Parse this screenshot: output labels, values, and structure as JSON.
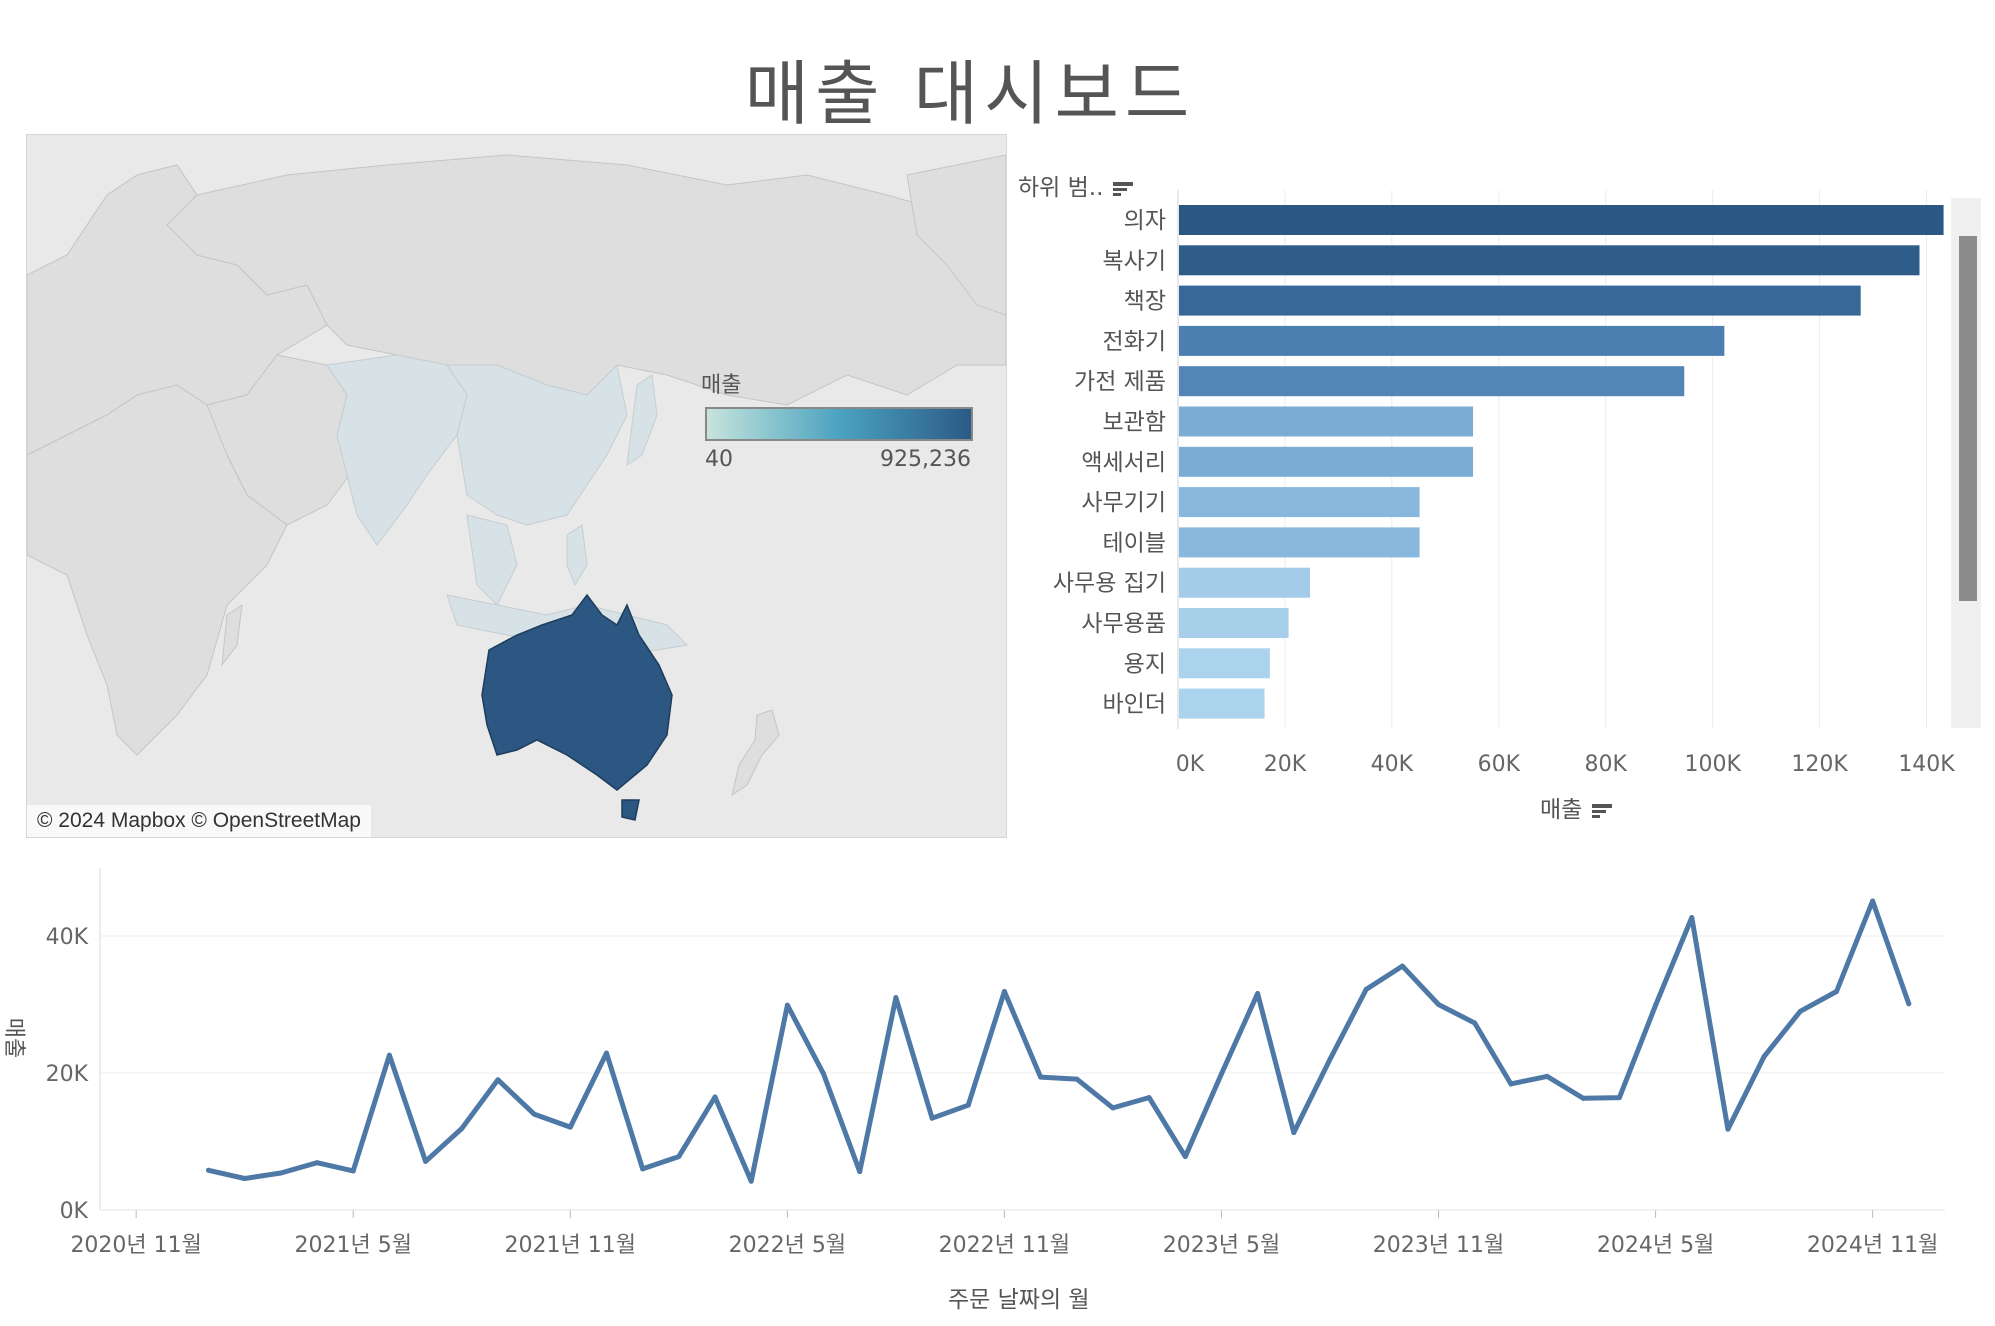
{
  "title": "매출 대시보드",
  "map": {
    "legend_title": "매출",
    "legend_min": "40",
    "legend_max": "925,236",
    "legend_colors": [
      "#c6e4dc",
      "#4ba3c0",
      "#2b5a87"
    ],
    "credit": "© 2024 Mapbox © OpenStreetMap",
    "highlight_color": "#2b5782",
    "asia_color": "#d7e2e6",
    "land_color": "#dcdcdc",
    "sea_color": "#e9e9e9"
  },
  "bar_chart": {
    "axis_title": "하위 범..",
    "x_title": "매출",
    "sort_icon": "sort-descending-icon"
  },
  "line_chart": {
    "x_title": "주문 날짜의 월",
    "y_title": "매출",
    "line_color": "#4e79a7"
  },
  "chart_data": [
    {
      "type": "bar",
      "orientation": "horizontal",
      "categories": [
        "의자",
        "복사기",
        "책장",
        "전화기",
        "가전 제품",
        "보관함",
        "액세서리",
        "사무기기",
        "테이블",
        "사무용 집기",
        "사무용품",
        "용지",
        "바인더"
      ],
      "values": [
        143000,
        138500,
        127500,
        102000,
        94500,
        55000,
        55000,
        45000,
        45000,
        24500,
        20500,
        17000,
        16000
      ],
      "colors": [
        "#2a5783",
        "#2f5d8a",
        "#386898",
        "#4c7fb1",
        "#5485b7",
        "#7aacd4",
        "#7aacd4",
        "#88b8dd",
        "#88b8dd",
        "#a4cbe8",
        "#a8cfea",
        "#acd3ee",
        "#acd3ee"
      ],
      "xlabel": "매출",
      "ylabel": "하위 범..",
      "xlim": [
        0,
        150000
      ],
      "ticks": [
        "0K",
        "20K",
        "40K",
        "60K",
        "80K",
        "100K",
        "120K",
        "140K"
      ],
      "grid": true
    },
    {
      "type": "line",
      "xlabel": "주문 날짜의 월",
      "ylabel": "매출",
      "x": [
        "2021-01",
        "2021-02",
        "2021-03",
        "2021-04",
        "2021-05",
        "2021-06",
        "2021-07",
        "2021-08",
        "2021-09",
        "2021-10",
        "2021-11",
        "2021-12",
        "2022-01",
        "2022-02",
        "2022-03",
        "2022-04",
        "2022-05",
        "2022-06",
        "2022-07",
        "2022-08",
        "2022-09",
        "2022-10",
        "2022-11",
        "2022-12",
        "2023-01",
        "2023-02",
        "2023-03",
        "2023-04",
        "2023-05",
        "2023-06",
        "2023-07",
        "2023-08",
        "2023-09",
        "2023-10",
        "2023-11",
        "2023-12",
        "2024-01",
        "2024-02",
        "2024-03",
        "2024-04",
        "2024-05",
        "2024-06",
        "2024-07",
        "2024-08",
        "2024-09",
        "2024-10",
        "2024-11",
        "2024-12"
      ],
      "values": [
        5800,
        4600,
        5400,
        6900,
        5700,
        22600,
        7100,
        11900,
        19000,
        14000,
        12100,
        22900,
        6000,
        7800,
        16500,
        4200,
        29900,
        19900,
        5600,
        31000,
        13400,
        15300,
        31900,
        19400,
        19100,
        14900,
        16400,
        7800,
        19900,
        31600,
        11300,
        22000,
        32200,
        35600,
        30000,
        27300,
        18400,
        19500,
        16300,
        16400,
        29900,
        42700,
        11800,
        22400,
        29000,
        31900,
        45100,
        30100
      ],
      "ylim": [
        0,
        47000
      ],
      "yticks": [
        "0K",
        "20K",
        "40K"
      ],
      "xticks": [
        "2020년 11월",
        "2021년 5월",
        "2021년 11월",
        "2022년 5월",
        "2022년 11월",
        "2023년 5월",
        "2023년 11월",
        "2024년 5월",
        "2024년 11월"
      ],
      "xtick_dates": [
        "2020-11",
        "2021-05",
        "2021-11",
        "2022-05",
        "2022-11",
        "2023-05",
        "2023-11",
        "2024-05",
        "2024-11"
      ],
      "grid": true
    }
  ]
}
